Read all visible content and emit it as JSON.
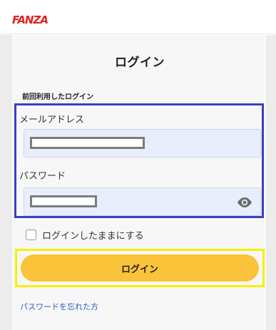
{
  "header": {
    "logo_text": "FANZA",
    "logo_color": "#e02020"
  },
  "login": {
    "title": "ログイン",
    "section_label": "前回利用したログイン",
    "email": {
      "label": "メールアドレス",
      "value_state": "redacted"
    },
    "password": {
      "label": "パスワード",
      "value_state": "redacted",
      "toggle_icon": "eye-icon"
    },
    "remember_label": "ログインしたままにする",
    "remember_checked": false,
    "submit_label": "ログイン",
    "forgot_link": "パスワードを忘れた方"
  },
  "colors": {
    "submit_button": "#fbc33a",
    "credentials_highlight": "#3b3fc4",
    "submit_highlight": "#f5f000",
    "link": "#2a5bbf"
  }
}
